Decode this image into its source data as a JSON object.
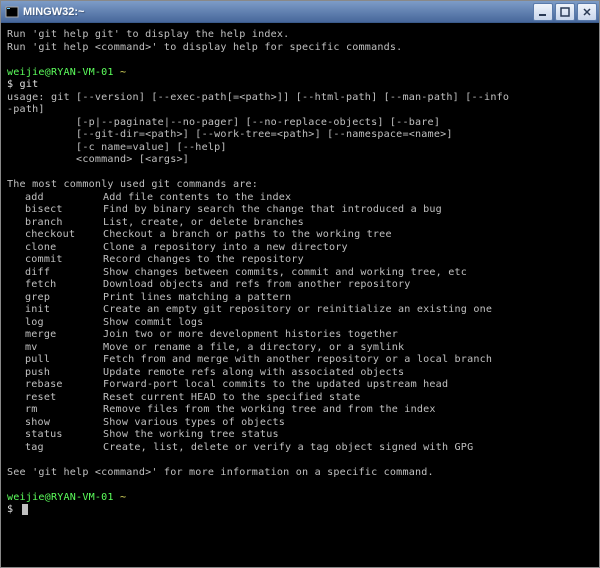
{
  "window": {
    "title": "MINGW32:~"
  },
  "help": {
    "line1": "Run 'git help git' to display the help index.",
    "line2": "Run 'git help <command>' to display help for specific commands."
  },
  "prompt1": {
    "userhost": "weijie@RYAN-VM-01",
    "path": " ~",
    "cmd": "$ git"
  },
  "usage": {
    "l1": "usage: git [--version] [--exec-path[=<path>]] [--html-path] [--man-path] [--info",
    "l2": "-path]",
    "l3": "           [-p|--paginate|--no-pager] [--no-replace-objects] [--bare]",
    "l4": "           [--git-dir=<path>] [--work-tree=<path>] [--namespace=<name>]",
    "l5": "           [-c name=value] [--help]",
    "l6": "           <command> [<args>]"
  },
  "commands_header": "The most commonly used git commands are:",
  "commands": [
    {
      "name": "add",
      "desc": "Add file contents to the index"
    },
    {
      "name": "bisect",
      "desc": "Find by binary search the change that introduced a bug"
    },
    {
      "name": "branch",
      "desc": "List, create, or delete branches"
    },
    {
      "name": "checkout",
      "desc": "Checkout a branch or paths to the working tree"
    },
    {
      "name": "clone",
      "desc": "Clone a repository into a new directory"
    },
    {
      "name": "commit",
      "desc": "Record changes to the repository"
    },
    {
      "name": "diff",
      "desc": "Show changes between commits, commit and working tree, etc"
    },
    {
      "name": "fetch",
      "desc": "Download objects and refs from another repository"
    },
    {
      "name": "grep",
      "desc": "Print lines matching a pattern"
    },
    {
      "name": "init",
      "desc": "Create an empty git repository or reinitialize an existing one"
    },
    {
      "name": "log",
      "desc": "Show commit logs"
    },
    {
      "name": "merge",
      "desc": "Join two or more development histories together"
    },
    {
      "name": "mv",
      "desc": "Move or rename a file, a directory, or a symlink"
    },
    {
      "name": "pull",
      "desc": "Fetch from and merge with another repository or a local branch"
    },
    {
      "name": "push",
      "desc": "Update remote refs along with associated objects"
    },
    {
      "name": "rebase",
      "desc": "Forward-port local commits to the updated upstream head"
    },
    {
      "name": "reset",
      "desc": "Reset current HEAD to the specified state"
    },
    {
      "name": "rm",
      "desc": "Remove files from the working tree and from the index"
    },
    {
      "name": "show",
      "desc": "Show various types of objects"
    },
    {
      "name": "status",
      "desc": "Show the working tree status"
    },
    {
      "name": "tag",
      "desc": "Create, list, delete or verify a tag object signed with GPG"
    }
  ],
  "footer": "See 'git help <command>' for more information on a specific command.",
  "prompt2": {
    "userhost": "weijie@RYAN-VM-01",
    "path": " ~",
    "cmd": "$ "
  }
}
